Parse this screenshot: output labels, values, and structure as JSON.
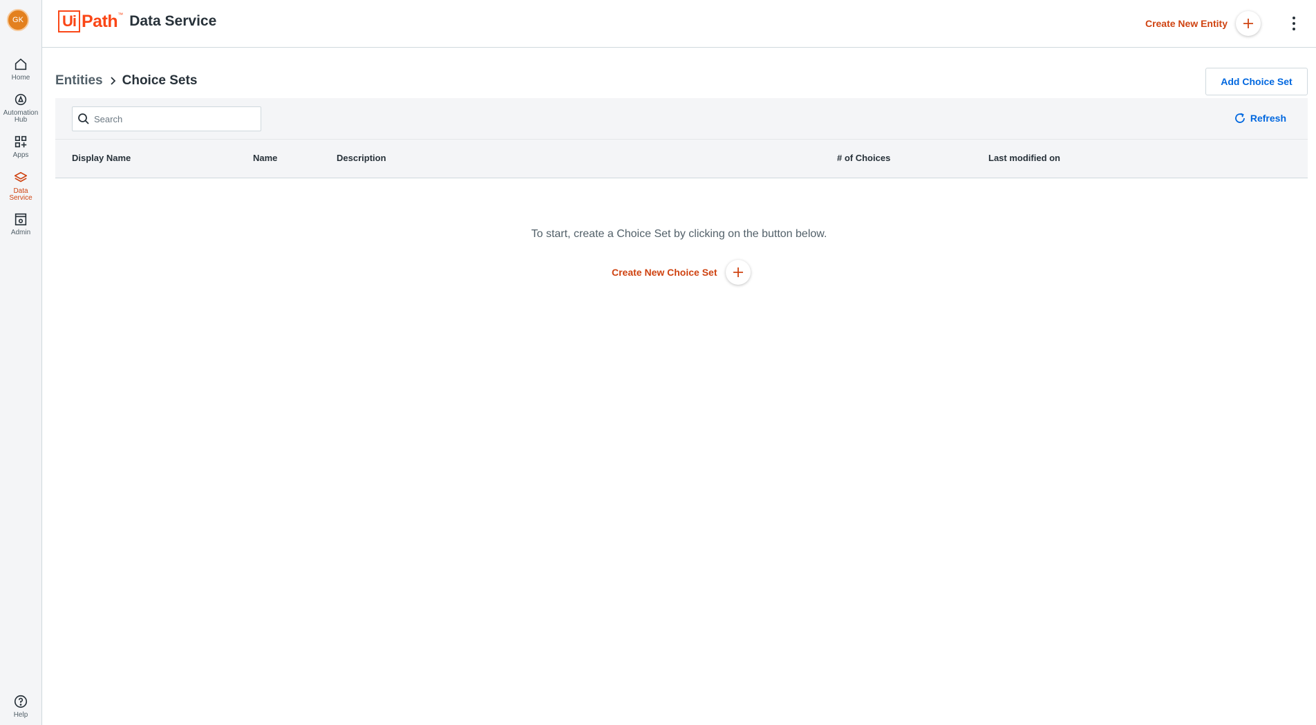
{
  "user": {
    "initials": "GK"
  },
  "nav": {
    "items": [
      {
        "label": "Home",
        "icon": "home-icon"
      },
      {
        "label": "Automation\nHub",
        "icon": "automation-hub-icon"
      },
      {
        "label": "Apps",
        "icon": "apps-icon"
      },
      {
        "label": "Data\nService",
        "icon": "layers-icon",
        "active": true
      },
      {
        "label": "Admin",
        "icon": "admin-icon"
      }
    ],
    "help_label": "Help"
  },
  "header": {
    "logo_ui": "Ui",
    "logo_path": "Path",
    "logo_tm": "™",
    "product": "Data Service",
    "create_label": "Create New Entity"
  },
  "breadcrumb": {
    "root": "Entities",
    "current": "Choice Sets"
  },
  "actions": {
    "add_label": "Add Choice Set",
    "refresh_label": "Refresh"
  },
  "search": {
    "placeholder": "Search",
    "value": ""
  },
  "table": {
    "columns": [
      "Display Name",
      "Name",
      "Description",
      "# of Choices",
      "Last modified on"
    ],
    "rows": []
  },
  "empty_state": {
    "message": "To start, create a Choice Set by clicking on the button below.",
    "create_label": "Create New Choice Set"
  },
  "colors": {
    "brand": "#fa4616",
    "accent_orange": "#cf4311",
    "accent_blue": "#0067df",
    "rail_bg": "#f4f5f7"
  }
}
